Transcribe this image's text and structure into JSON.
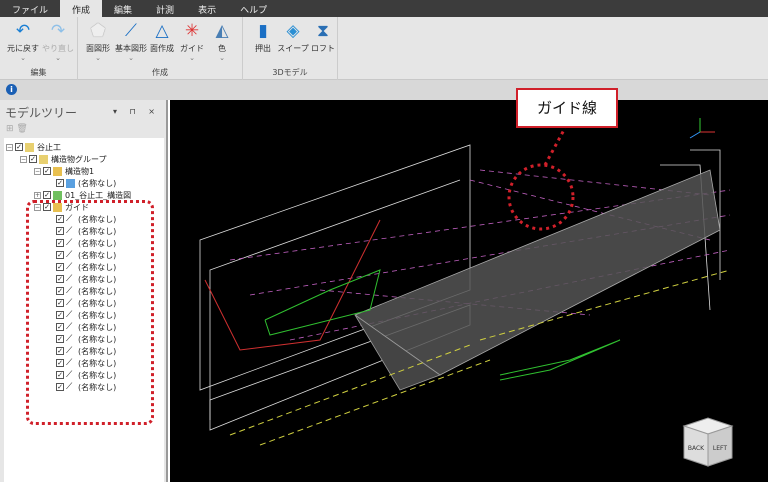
{
  "menu": [
    "ファイル",
    "作成",
    "編集",
    "計測",
    "表示",
    "ヘルプ"
  ],
  "ribbon": {
    "groups": [
      {
        "label": "編集",
        "buttons": [
          {
            "label": "元に戻す",
            "icon": "undo-icon"
          },
          {
            "label": "やり直し",
            "icon": "redo-icon",
            "disabled": true
          }
        ]
      },
      {
        "label": "作成",
        "buttons": [
          {
            "label": "面図形",
            "icon": "pentagon-icon"
          },
          {
            "label": "基本図形",
            "icon": "line-icon"
          },
          {
            "label": "面作成",
            "icon": "triangle-icon"
          },
          {
            "label": "ガイド",
            "icon": "guide-icon"
          },
          {
            "label": "色",
            "icon": "paint-bucket-icon"
          }
        ]
      },
      {
        "label": "3Dモデル",
        "buttons": [
          {
            "label": "押出",
            "icon": "extrude-icon"
          },
          {
            "label": "スイープ",
            "icon": "sweep-icon"
          },
          {
            "label": "ロフト",
            "icon": "loft-icon"
          }
        ]
      }
    ]
  },
  "panel": {
    "title": "モデルツリー",
    "controls": "▾ ⊓ ×"
  },
  "tree": {
    "root": "谷止工",
    "group": "構造物グループ",
    "structure": "構造物1",
    "unnamed": "(名称なし)",
    "drawing": "01_谷止工_構造図",
    "guide": "ガイド",
    "guide_children": [
      "(名称なし)",
      "(名称なし)",
      "(名称なし)",
      "(名称なし)",
      "(名称なし)",
      "(名称なし)",
      "(名称なし)",
      "(名称なし)",
      "(名称なし)",
      "(名称なし)",
      "(名称なし)",
      "(名称なし)",
      "(名称なし)",
      "(名称なし)",
      "(名称なし)"
    ]
  },
  "callout": "ガイド線",
  "viewcube": {
    "back": "BACK",
    "left": "LEFT"
  },
  "colors": {
    "highlight": "#d0202a",
    "guide": "#c060c0",
    "accent": "#1a5fb4"
  }
}
